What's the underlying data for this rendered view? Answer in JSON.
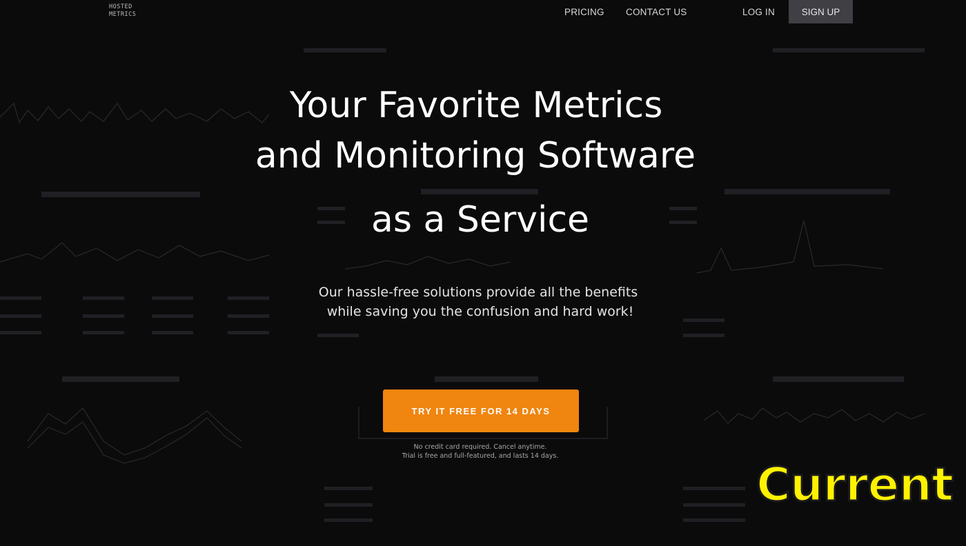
{
  "header": {
    "logo_lines": [
      "HOSTED",
      "METRICS"
    ],
    "nav": {
      "pricing": "PRICING",
      "contact": "CONTACT US",
      "login": "LOG IN",
      "signup": "SIGN UP"
    }
  },
  "hero": {
    "title_lines": [
      "Your Favorite Metrics",
      "and Monitoring Software",
      "as a Service"
    ],
    "subtitle_lines": [
      "Our hassle-free solutions provide all the benefits",
      "while saving you the confusion and hard work!"
    ],
    "cta_label": "TRY IT FREE FOR 14 DAYS",
    "fine_print": [
      "No credit card required. Cancel anytime.",
      "Trial is free and full-featured, and lasts 14 days."
    ]
  },
  "overlay": {
    "stamp_text": "Current"
  },
  "colors": {
    "background": "#0b0b0c",
    "cta": "#f0850f",
    "signup_bg": "#3f3f44",
    "stamp": "#fff200"
  }
}
